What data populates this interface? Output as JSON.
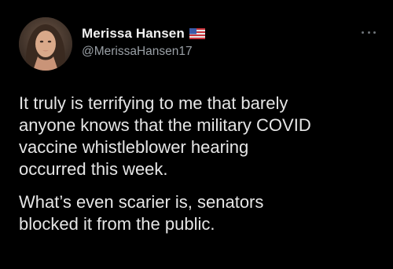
{
  "tweet": {
    "display_name": "Merissa Hansen",
    "handle": "@MerissaHansen17",
    "flag_icon": "us-flag-icon",
    "more_icon": "more-options-icon",
    "paragraphs": [
      "It truly is terrifying to me that barely\nanyone knows that the military COVID\nvaccine whistleblower hearing\noccurred this week.",
      "What’s even scarier is, senators\nblocked it from the public."
    ]
  },
  "colors": {
    "background": "#000000",
    "text": "#e7e9ea",
    "secondary_text": "#9aa0a6"
  }
}
